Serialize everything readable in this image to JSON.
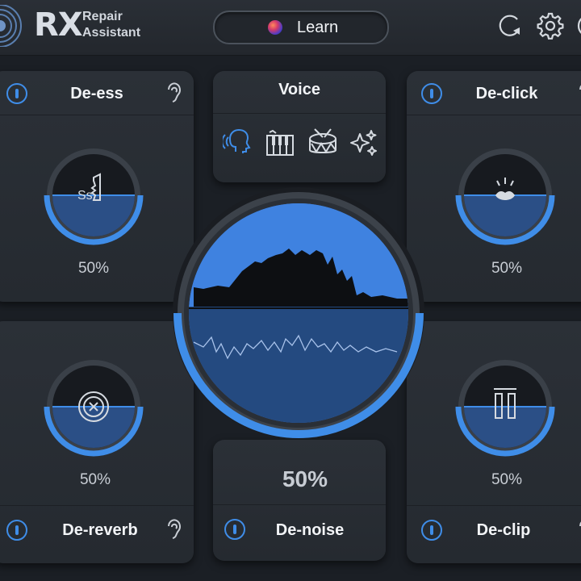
{
  "header": {
    "logo_rx": "RX",
    "logo_line1": "Repair",
    "logo_line2": "Assistant",
    "learn_label": "Learn"
  },
  "voice": {
    "title": "Voice",
    "modes": [
      "voice-icon",
      "piano-icon",
      "drum-icon",
      "sparkle-icon"
    ]
  },
  "modules": {
    "de_ess": {
      "title": "De-ess",
      "amount": "50%",
      "fill": 0.5,
      "icon": "sibilance-icon"
    },
    "de_click": {
      "title": "De-click",
      "amount": "50%",
      "fill": 0.5,
      "icon": "mouth-click-icon"
    },
    "de_reverb": {
      "title": "De-reverb",
      "amount": "50%",
      "fill": 0.5,
      "icon": "reverb-target-icon"
    },
    "de_clip": {
      "title": "De-clip",
      "amount": "50%",
      "fill": 0.5,
      "icon": "clip-bars-icon"
    },
    "de_noise": {
      "title": "De-noise",
      "amount": "50%",
      "fill": 0.5
    }
  },
  "colors": {
    "accent": "#3f8de8",
    "fill": "#2b4f86",
    "background": "#1b1f25",
    "panel": "#2b3037"
  }
}
